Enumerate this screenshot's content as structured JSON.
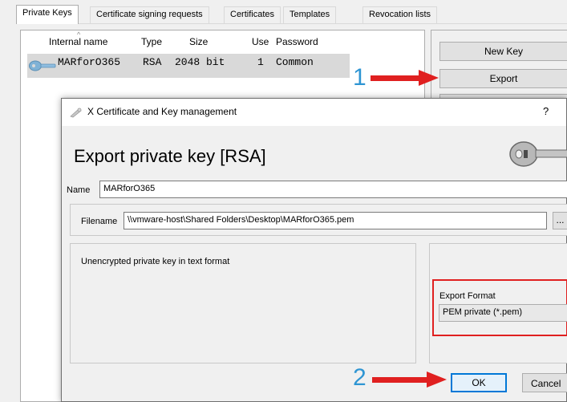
{
  "tabs": [
    {
      "label": "Private Keys"
    },
    {
      "label": "Certificate signing requests"
    },
    {
      "label": "Certificates"
    },
    {
      "label": "Templates"
    },
    {
      "label": "Revocation lists"
    }
  ],
  "keylist": {
    "headers": {
      "internal_name": "Internal name",
      "type": "Type",
      "size": "Size",
      "use": "Use",
      "password": "Password"
    },
    "rows": [
      {
        "internal_name": "MARforO365",
        "type": "RSA",
        "size": "2048 bit",
        "use": "1",
        "password": "Common"
      }
    ]
  },
  "right_buttons": {
    "new_key": "New Key",
    "export": "Export"
  },
  "annotations": {
    "step1": "1",
    "step2": "2",
    "arrow_color": "#e02020",
    "number_color": "#2e95d3"
  },
  "dialog": {
    "title": "X Certificate and Key management",
    "help": "?",
    "heading": "Export private key [RSA]",
    "name_label": "Name",
    "name_value": "MARforO365",
    "filename_label": "Filename",
    "filename_value": "\\\\vmware-host\\Shared Folders\\Desktop\\MARforO365.pem",
    "browse_label": "...",
    "description": "Unencrypted private key in text format",
    "format_label": "Export Format",
    "format_value": "PEM private (*.pem)",
    "ok_label": "OK",
    "cancel_label": "Cancel",
    "highlight_color": "#e02020"
  }
}
